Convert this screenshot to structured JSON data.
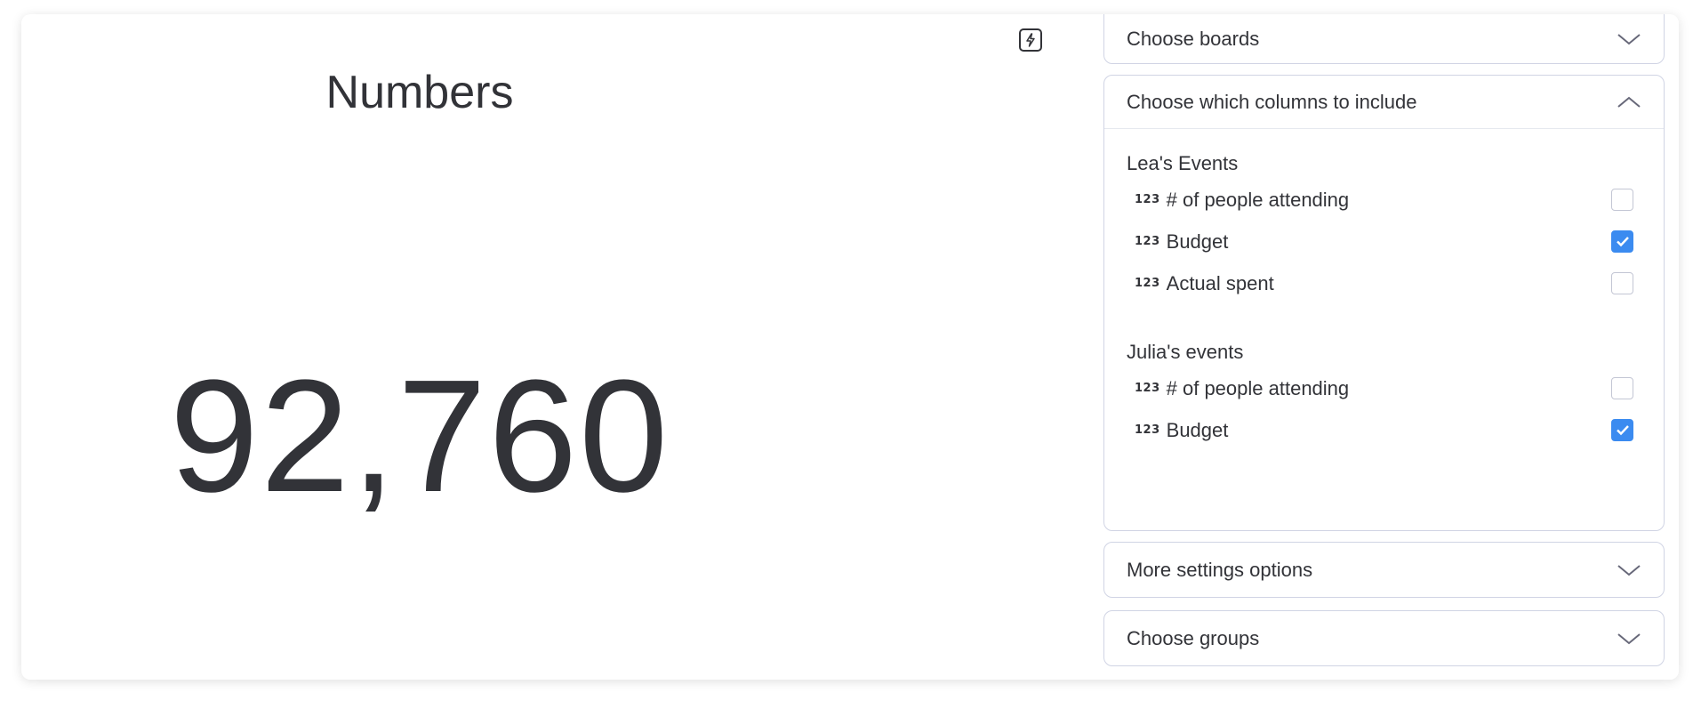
{
  "widget": {
    "title": "Numbers",
    "value": "92,760",
    "bolt_icon": "lightning-icon"
  },
  "panel": {
    "choose_boards": "Choose boards",
    "choose_columns": "Choose which columns to include",
    "more_settings": "More settings options",
    "choose_groups": "Choose groups",
    "boards": [
      {
        "name": "Lea's Events",
        "columns": [
          {
            "icon": "123",
            "label": "# of people attending",
            "checked": false
          },
          {
            "icon": "123",
            "label": "Budget",
            "checked": true
          },
          {
            "icon": "123",
            "label": "Actual spent",
            "checked": false
          }
        ]
      },
      {
        "name": "Julia's events",
        "columns": [
          {
            "icon": "123",
            "label": "# of people attending",
            "checked": false
          },
          {
            "icon": "123",
            "label": "Budget",
            "checked": true
          }
        ]
      }
    ]
  },
  "colors": {
    "accent": "#3b8bf0",
    "text": "#323338",
    "border": "#d0d4e4"
  }
}
